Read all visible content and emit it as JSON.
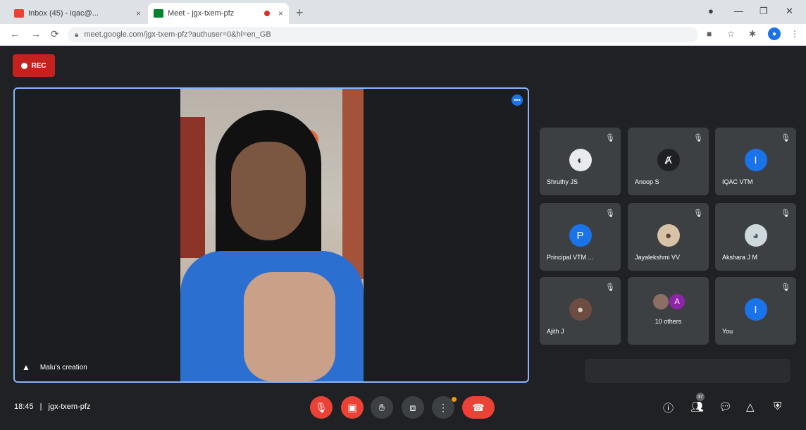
{
  "browser": {
    "tabs": [
      {
        "title": "Inbox (45) - iqac@...",
        "close": "×"
      },
      {
        "title": "Meet - jgx-txem-pfz",
        "close": "×"
      }
    ],
    "new_tab": "+",
    "url": "meet.google.com/jgx-txem-pfz?authuser=0&hl=en_GB",
    "window": {
      "minimize": "—",
      "maximize": "❐",
      "close": "✕"
    }
  },
  "meet": {
    "recording_label": "REC",
    "main_speaker": "Malu's creation",
    "participants": [
      {
        "name": "Shruthy JS",
        "avatar": "◐",
        "color": "#e8eaed"
      },
      {
        "name": "Anoop S",
        "avatar": "Ⱥ",
        "color": "#202124"
      },
      {
        "name": "IQAC VTM",
        "avatar": "I",
        "color": "#1a73e8"
      },
      {
        "name": "Principal VTM ...",
        "avatar": "P",
        "color": "#1a73e8"
      },
      {
        "name": "Jayalekshmi VV",
        "avatar": "●",
        "color": "#d7c2a8"
      },
      {
        "name": "Akshara J M",
        "avatar": "◕",
        "color": "#cfd8dc"
      },
      {
        "name": "Ajith J",
        "avatar": "●",
        "color": "#6d4c41"
      },
      {
        "name": "10 others",
        "avatar": "A",
        "color": "#8e24aa"
      },
      {
        "name": "You",
        "avatar": "I",
        "color": "#1a73e8"
      }
    ],
    "time": "18:45",
    "separator": "|",
    "meeting_code": "jgx-txem-pfz",
    "people_count": "37"
  }
}
